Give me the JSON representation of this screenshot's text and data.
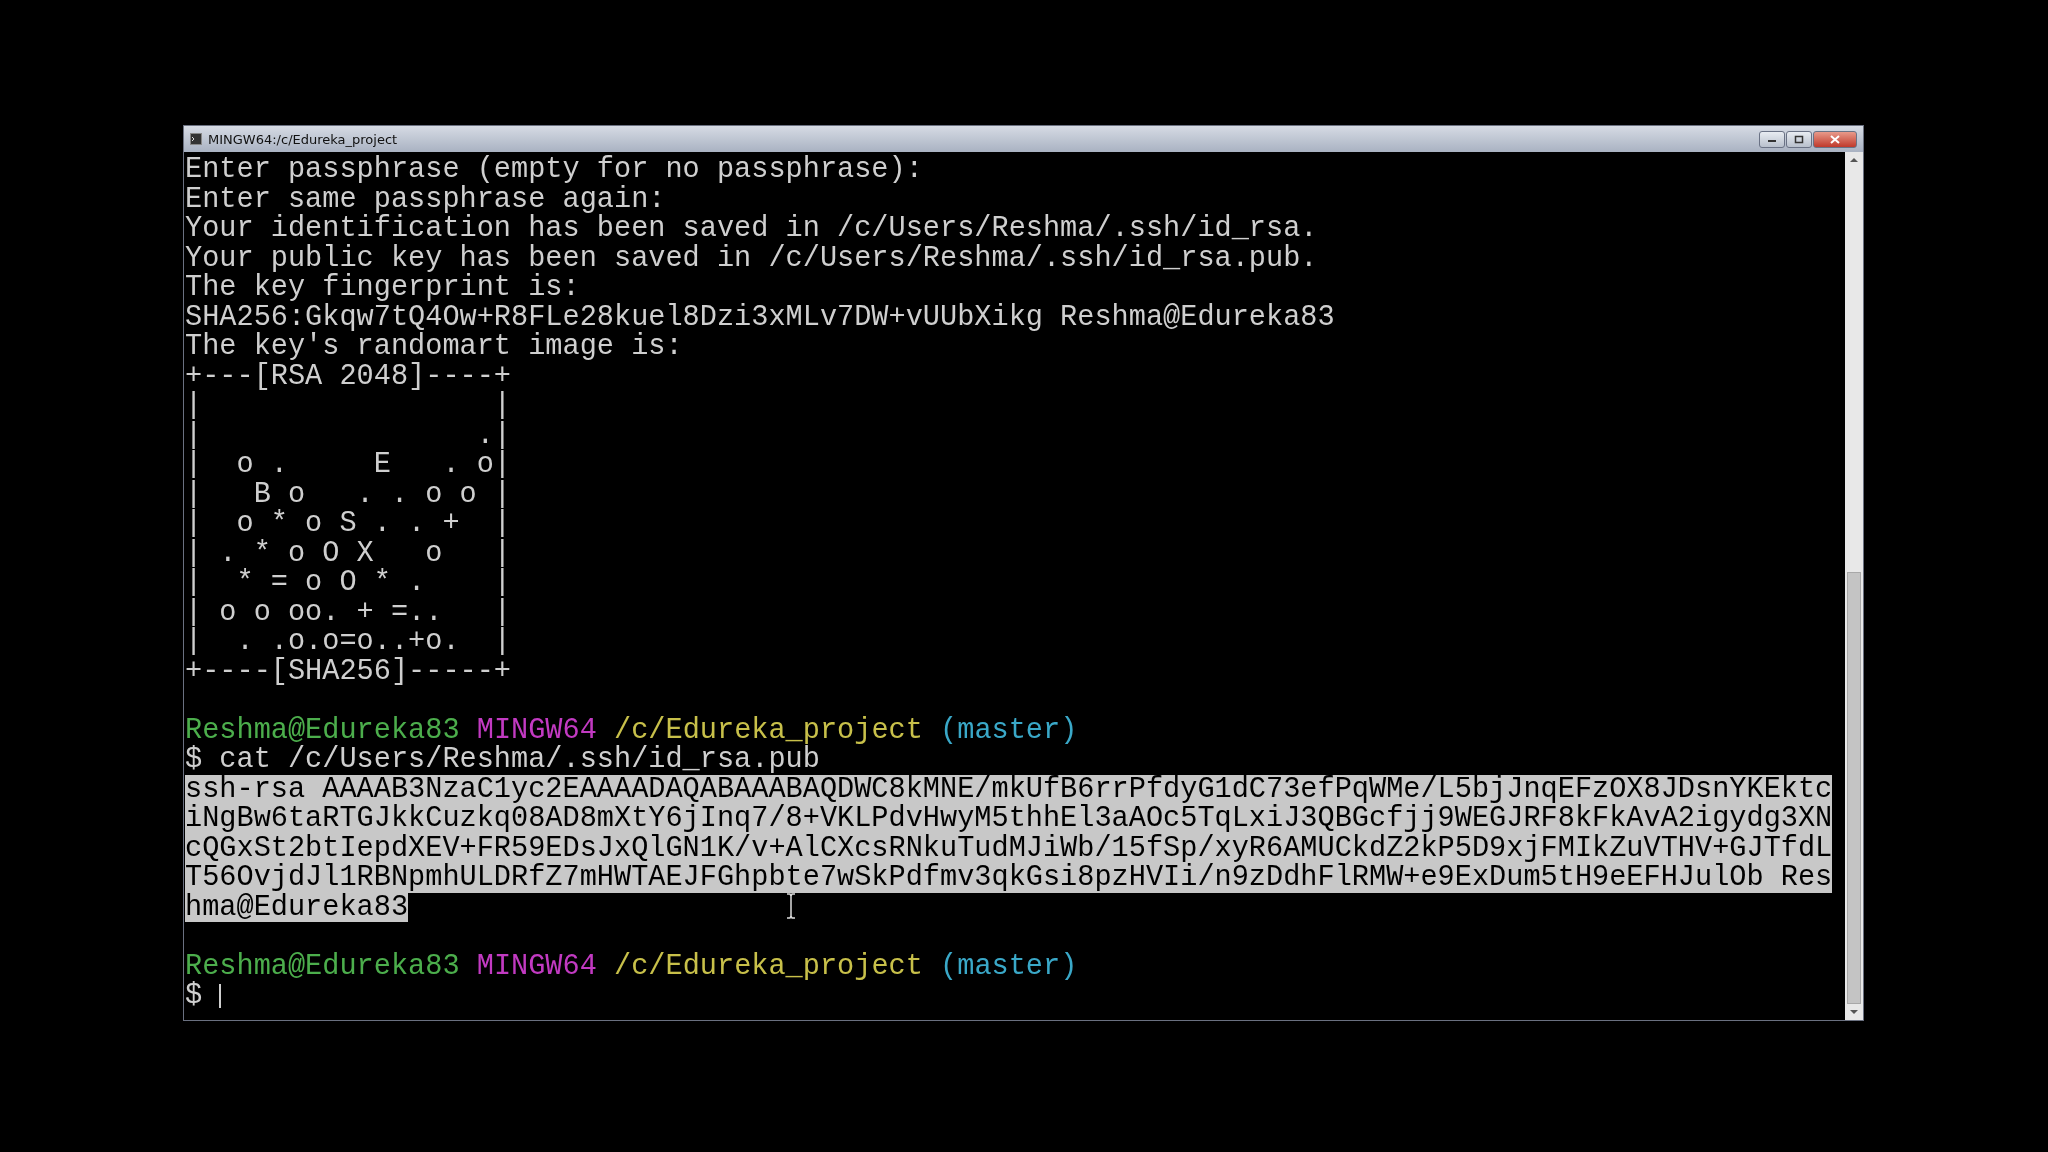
{
  "window": {
    "title": "MINGW64:/c/Edureka_project"
  },
  "terminal": {
    "lines": [
      {
        "kind": "output",
        "text": "Enter passphrase (empty for no passphrase):",
        "selected": false
      },
      {
        "kind": "output",
        "text": "Enter same passphrase again:",
        "selected": false
      },
      {
        "kind": "output",
        "text": "Your identification has been saved in /c/Users/Reshma/.ssh/id_rsa.",
        "selected": false
      },
      {
        "kind": "output",
        "text": "Your public key has been saved in /c/Users/Reshma/.ssh/id_rsa.pub.",
        "selected": false
      },
      {
        "kind": "output",
        "text": "The key fingerprint is:",
        "selected": false
      },
      {
        "kind": "output",
        "text": "SHA256:Gkqw7tQ4Ow+R8FLe28kuel8Dzi3xMLv7DW+vUUbXikg Reshma@Edureka83",
        "selected": false
      },
      {
        "kind": "output",
        "text": "The key's randomart image is:",
        "selected": false
      },
      {
        "kind": "output",
        "text": "+---[RSA 2048]----+",
        "selected": false
      },
      {
        "kind": "output",
        "text": "|                 |",
        "selected": false
      },
      {
        "kind": "output",
        "text": "|                .|",
        "selected": false
      },
      {
        "kind": "output",
        "text": "|  o .     E   . o|",
        "selected": false
      },
      {
        "kind": "output",
        "text": "|   B o   . . o o |",
        "selected": false
      },
      {
        "kind": "output",
        "text": "|  o * o S . . +  |",
        "selected": false
      },
      {
        "kind": "output",
        "text": "| . * o O X   o   |",
        "selected": false
      },
      {
        "kind": "output",
        "text": "|  * = o O * .    |",
        "selected": false
      },
      {
        "kind": "output",
        "text": "| o o oo. + =..   |",
        "selected": false
      },
      {
        "kind": "output",
        "text": "|  . .o.o=o..+o.  |",
        "selected": false
      },
      {
        "kind": "output",
        "text": "+----[SHA256]-----+",
        "selected": false
      },
      {
        "kind": "blank"
      },
      {
        "kind": "prompt",
        "user": "Reshma@Edureka83",
        "system": "MINGW64",
        "path": "/c/Edureka_project",
        "branch": "(master)"
      },
      {
        "kind": "output",
        "text": "$ cat /c/Users/Reshma/.ssh/id_rsa.pub",
        "selected": false
      },
      {
        "kind": "output",
        "text": "ssh-rsa AAAAB3NzaC1yc2EAAAADAQABAAABAQDWC8kMNE/mkUfB6rrPfdyG1dC73efPqWMe/L5bjJnqEFzOX8JDsnYKEktc",
        "selected": true
      },
      {
        "kind": "output",
        "text": "iNgBw6taRTGJkkCuzkq08AD8mXtY6jInq7/8+VKLPdvHwyM5thhEl3aAOc5TqLxiJ3QBGcfjj9WEGJRF8kFkAvA2igydg3XN",
        "selected": true
      },
      {
        "kind": "output",
        "text": "cQGxSt2btIepdXEV+FR59EDsJxQlGN1K/v+AlCXcsRNkuTudMJiWb/15fSp/xyR6AMUCkdZ2kP5D9xjFMIkZuVTHV+GJTfdL",
        "selected": true
      },
      {
        "kind": "output",
        "text": "T56OvjdJl1RBNpmhULDRfZ7mHWTAEJFGhpbte7wSkPdfmv3qkGsi8pzHVIi/n9zDdhFlRMW+e9ExDum5tH9eEFHJulOb Res",
        "selected": true
      },
      {
        "kind": "output",
        "text": "hma@Edureka83",
        "selected": true
      },
      {
        "kind": "blank"
      },
      {
        "kind": "prompt",
        "user": "Reshma@Edureka83",
        "system": "MINGW64",
        "path": "/c/Edureka_project",
        "branch": "(master)"
      },
      {
        "kind": "input",
        "prompt": "$"
      }
    ]
  }
}
